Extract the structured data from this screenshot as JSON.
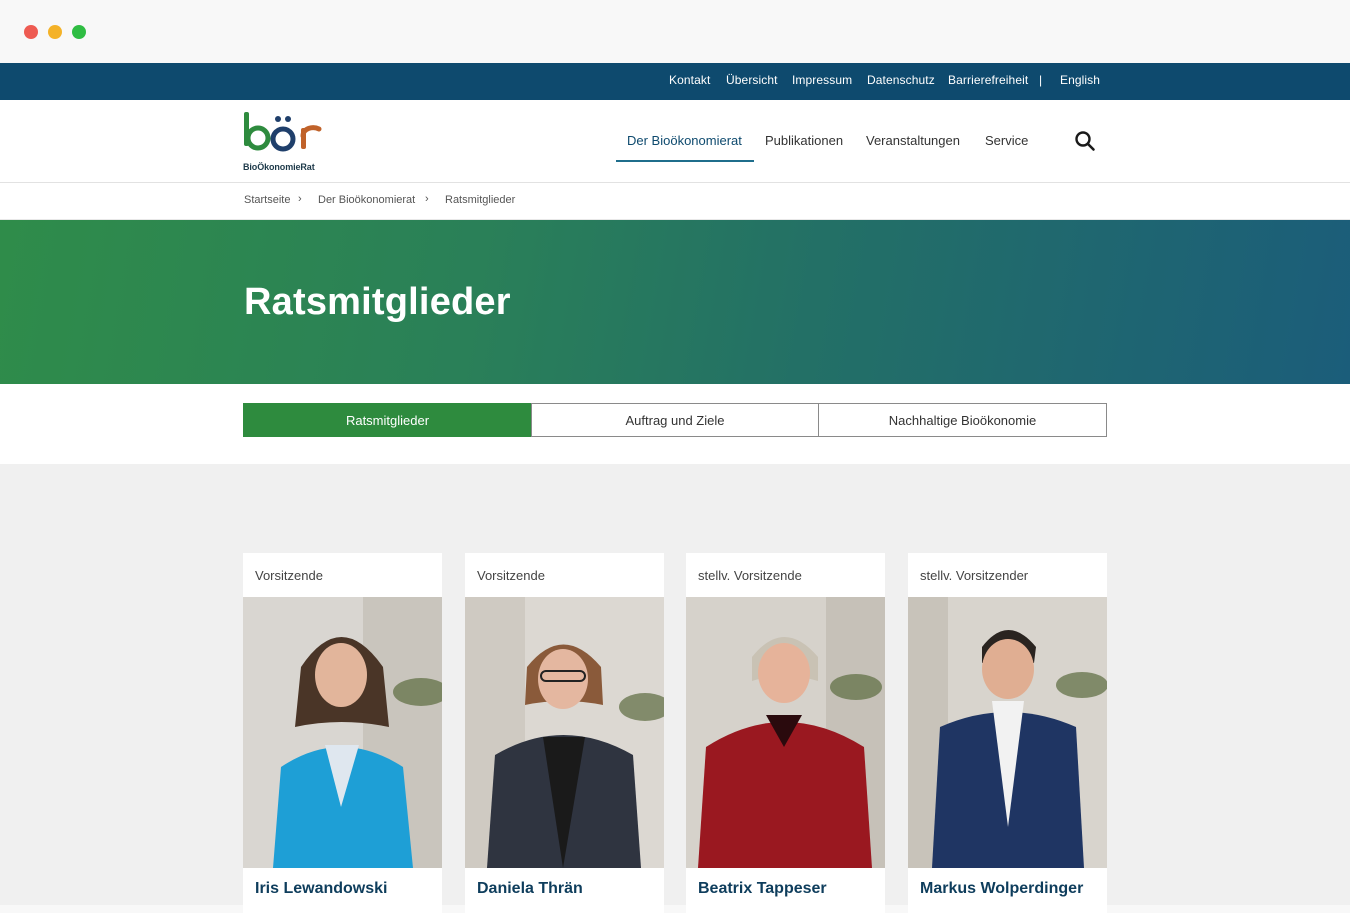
{
  "meta_nav": {
    "kontakt": "Kontakt",
    "uebersicht": "Übersicht",
    "impressum": "Impressum",
    "datenschutz": "Datenschutz",
    "barrierefreiheit": "Barrierefreiheit",
    "separator": "|",
    "english": "English"
  },
  "logo": {
    "mark": "böer",
    "subtitle": "BioÖkonomieRat"
  },
  "main_nav": {
    "items": [
      {
        "label": "Der Bioökonomierat",
        "active": true
      },
      {
        "label": "Publikationen",
        "active": false
      },
      {
        "label": "Veranstaltungen",
        "active": false
      },
      {
        "label": "Service",
        "active": false
      }
    ],
    "search_icon": "search-icon"
  },
  "breadcrumb": {
    "items": [
      "Startseite",
      "Der Bioökonomierat",
      "Ratsmitglieder"
    ],
    "separator": "›"
  },
  "hero": {
    "title": "Ratsmitglieder"
  },
  "tabs": [
    {
      "label": "Ratsmitglieder",
      "active": true
    },
    {
      "label": "Auftrag und Ziele",
      "active": false
    },
    {
      "label": "Nachhaltige Bioökonomie",
      "active": false
    }
  ],
  "members": [
    {
      "role": "Vorsitzende",
      "name": "Iris Lewandowski",
      "jacket": "#1e9fd6",
      "hair": "#4a3527",
      "shirt": "#dfe7ef"
    },
    {
      "role": "Vorsitzende",
      "name": "Daniela Thrän",
      "jacket": "#2f3440",
      "hair": "#8a5a3a",
      "shirt": "#1a1a1a"
    },
    {
      "role": "stellv. Vorsitzende",
      "name": "Beatrix Tappeser",
      "jacket": "#9a1820",
      "hair": "#c9c2b4",
      "shirt": "#2a0a0d"
    },
    {
      "role": "stellv. Vorsitzender",
      "name": "Markus Wolperdinger",
      "jacket": "#1f3563",
      "hair": "#2a2420",
      "shirt": "#f2f2f2"
    }
  ],
  "colors": {
    "meta_bar": "#0e4a6e",
    "accent_green": "#2e8b3e",
    "name_blue": "#0e3d5c",
    "hero_gradient_start": "#2f8c4a",
    "hero_gradient_end": "#1b5d7a"
  }
}
